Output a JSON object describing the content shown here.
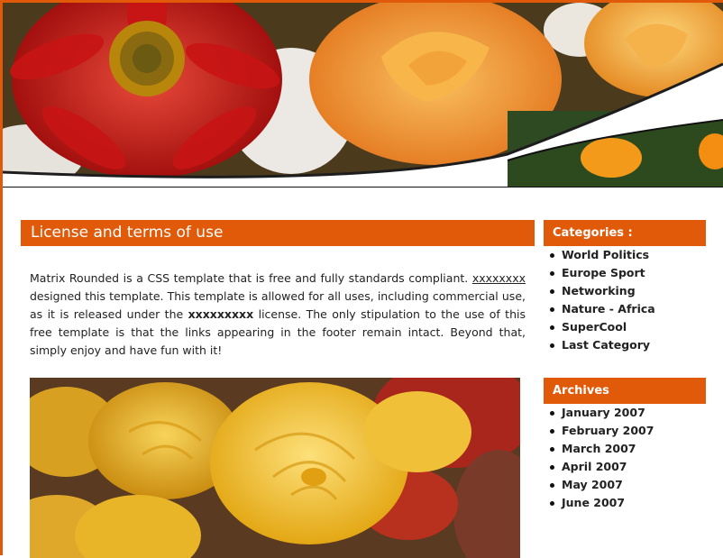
{
  "colors": {
    "accent": "#e05a0a",
    "text": "#222222"
  },
  "main": {
    "heading": "License and terms of use",
    "intro": {
      "part1": "Matrix Rounded is a CSS template that is free and fully standards compliant. ",
      "author_link": "xxxxxxxx",
      "part2": " designed this template. This template is allowed for all uses, including commercial use, as it is released under the ",
      "license_bold": "xxxxxxxxx",
      "part3": " license. The only stipulation to the use of this free template is that the links appearing in the footer remain intact. Beyond that, simply enjoy and have fun with it!"
    }
  },
  "sidebar": {
    "categories_title": "Categories :",
    "categories": [
      "World Politics",
      "Europe Sport",
      "Networking",
      "Nature - Africa",
      "SuperCool",
      "Last Category"
    ],
    "archives_title": "Archives",
    "archives": [
      "January 2007",
      "February 2007",
      "March 2007",
      "April 2007",
      "May 2007",
      "June 2007"
    ]
  }
}
